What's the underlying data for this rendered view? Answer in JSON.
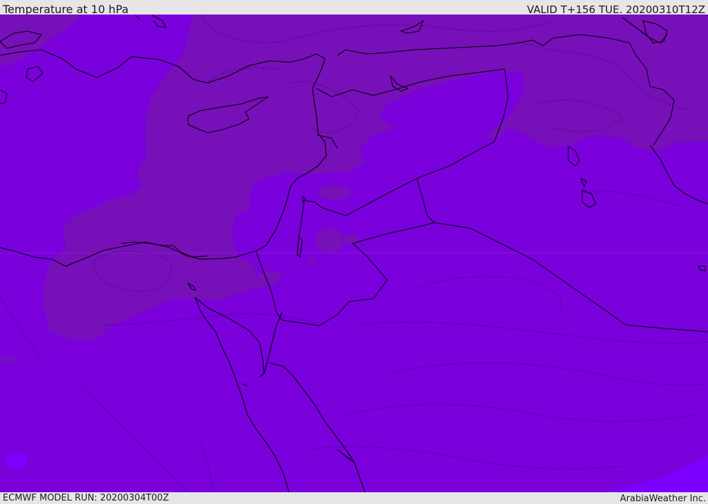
{
  "header": {
    "title": "Temperature at 10 hPa",
    "valid_time": "VALID T+156 TUE. 20200310T12Z"
  },
  "footer": {
    "model_run": "ECMWF MODEL RUN: 20200304T00Z",
    "credit": "ArabiaWeather Inc."
  },
  "map": {
    "region": "Eastern Mediterranean / Middle East",
    "colors": {
      "field_warm": "#7a00dc",
      "field_cool": "#7710b8",
      "field_warmest": "#7b00ff",
      "coastline": "#000000",
      "contour": "#2a0050"
    }
  }
}
